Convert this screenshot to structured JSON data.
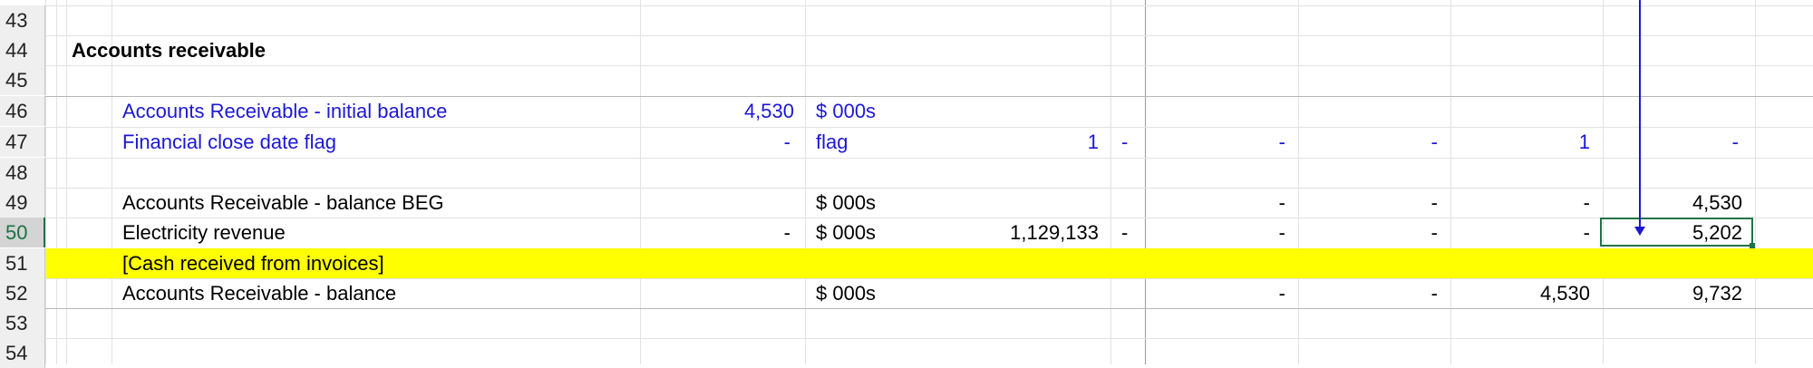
{
  "rows": [
    {
      "num": "43"
    },
    {
      "num": "44",
      "label": "Accounts receivable"
    },
    {
      "num": "45"
    },
    {
      "num": "46",
      "label": "Accounts Receivable - initial balance",
      "value": "4,530",
      "unit": "$ 000s"
    },
    {
      "num": "47",
      "label": "Financial close date flag",
      "value": "-",
      "unit": "flag",
      "total": "1",
      "c1": "-",
      "c2": "-",
      "c3": "-",
      "c4": "1",
      "c5": "-"
    },
    {
      "num": "48"
    },
    {
      "num": "49",
      "label": "Accounts Receivable - balance BEG",
      "unit": "$ 000s",
      "c2": "-",
      "c3": "-",
      "c4": "-",
      "c5": "4,530"
    },
    {
      "num": "50",
      "label": "Electricity revenue",
      "value": "-",
      "unit": "$ 000s",
      "total": "1,129,133",
      "c1": "-",
      "c2": "-",
      "c3": "-",
      "c4": "-",
      "c5": "5,202"
    },
    {
      "num": "51",
      "label": "[Cash received from invoices]"
    },
    {
      "num": "52",
      "label": "Accounts Receivable - balance",
      "unit": "$ 000s",
      "c2": "-",
      "c3": "-",
      "c4": "4,530",
      "c5": "9,732"
    },
    {
      "num": "53"
    },
    {
      "num": "54"
    }
  ],
  "colors": {
    "input_blue": "#1c17d6",
    "highlight": "#ffff00",
    "selection": "#217346"
  }
}
